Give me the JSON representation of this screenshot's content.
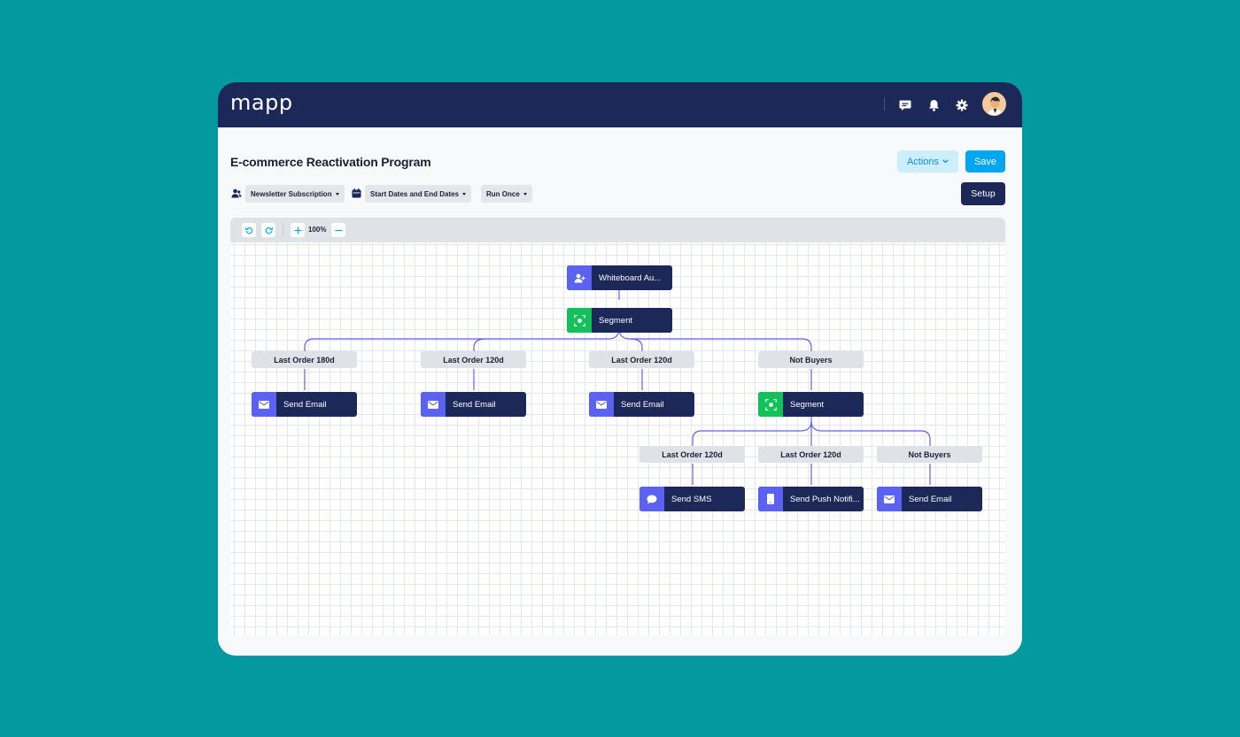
{
  "app": {
    "logo": "mapp"
  },
  "header_icons": [
    "chat-icon",
    "bell-icon",
    "gear-icon",
    "avatar"
  ],
  "page": {
    "title": "E-commerce Reactivation Program"
  },
  "buttons": {
    "actions": "Actions",
    "save": "Save",
    "setup": "Setup"
  },
  "filters": {
    "audience": "Newsletter Subscription",
    "dates": "Start Dates and End Dates",
    "frequency": "Run Once"
  },
  "toolbar": {
    "zoom": "100%"
  },
  "flow": {
    "root": {
      "label": "Whiteboard Au...",
      "icon": "user-plus-icon"
    },
    "segment1": {
      "label": "Segment",
      "icon": "segment-icon"
    },
    "branches1": [
      {
        "label": "Last Order 180d",
        "action": "Send Email"
      },
      {
        "label": "Last Order 120d",
        "action": "Send Email"
      },
      {
        "label": "Last Order 120d",
        "action": "Send Email"
      },
      {
        "label": "Not Buyers",
        "action": "Segment"
      }
    ],
    "branches2": [
      {
        "label": "Last Order 120d",
        "action": "Send SMS"
      },
      {
        "label": "Last Order 120d",
        "action": "Send Push Notifi..."
      },
      {
        "label": "Not Buyers",
        "action": "Send Email"
      }
    ]
  },
  "colors": {
    "background": "#03999f",
    "navy": "#1b2858",
    "accent_blue": "#00a6ef",
    "node_icon_blue": "#5b61f0",
    "node_icon_green": "#12c15a",
    "connector": "#6a5cf0"
  }
}
